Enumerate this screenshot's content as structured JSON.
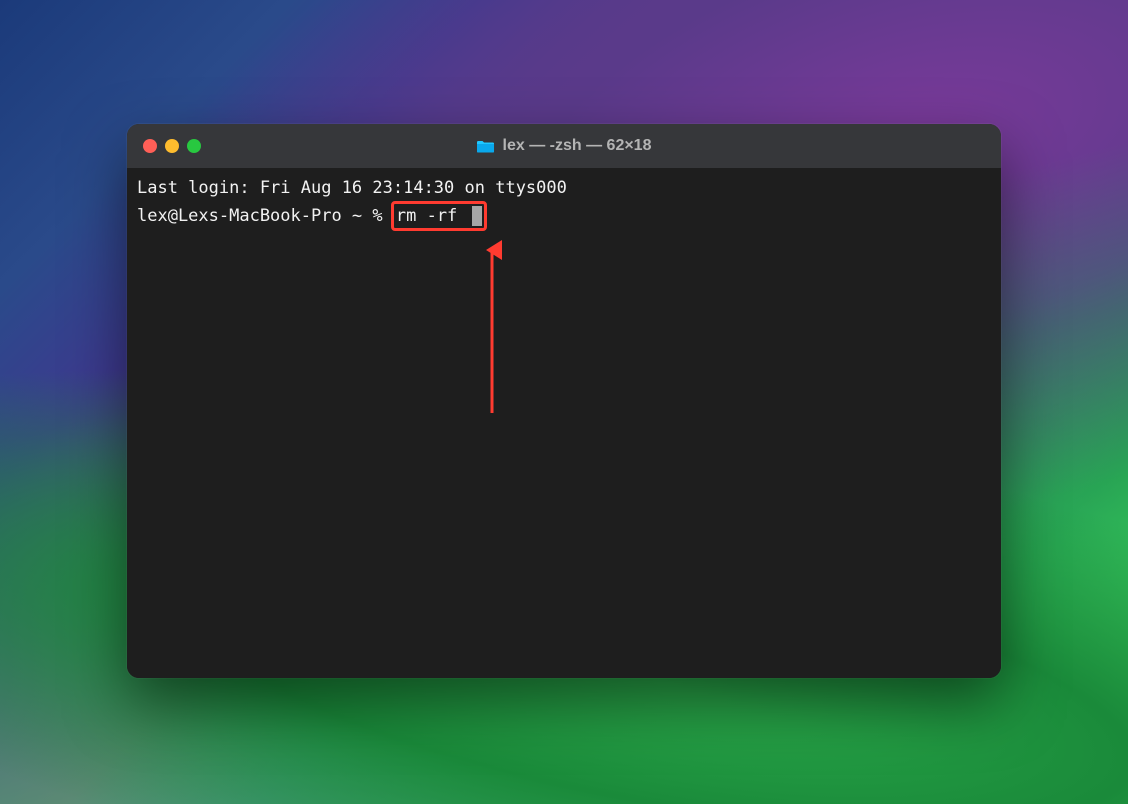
{
  "window": {
    "title": "lex — -zsh — 62×18"
  },
  "terminal": {
    "last_login": "Last login: Fri Aug 16 23:14:30 on ttys000",
    "prompt": "lex@Lexs-MacBook-Pro ~ % ",
    "command": "rm -rf "
  },
  "annotation": {
    "highlight_color": "#ff3b30"
  }
}
